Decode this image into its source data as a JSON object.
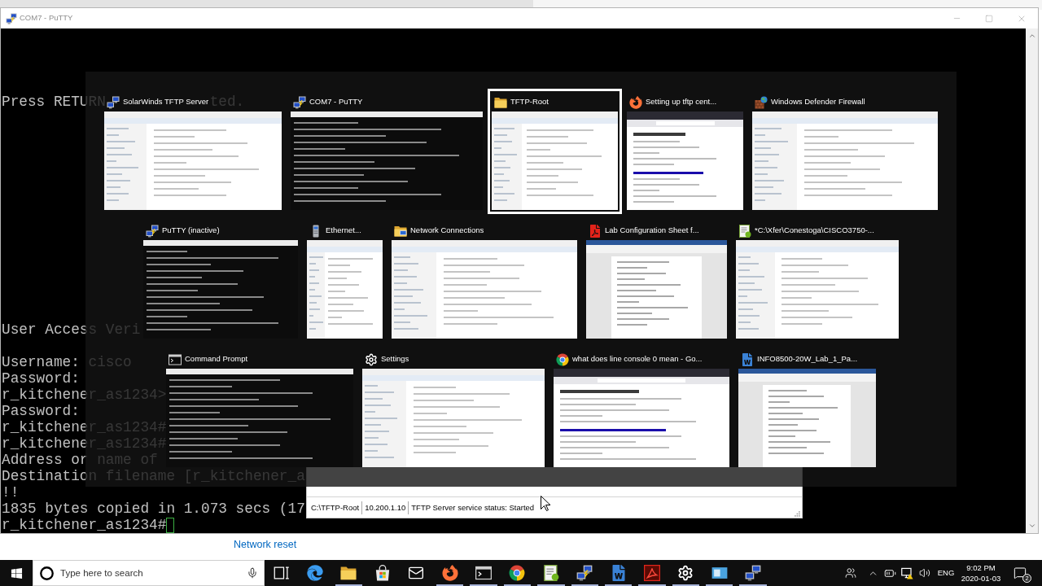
{
  "putty_window": {
    "title": "COM7 - PuTTY",
    "terminal_lines": [
      "Press RETURN            ted.",
      "User Access Veri",
      "Username: cisco",
      "Password:",
      "r_kitchener_as1234>",
      "Password:",
      "r_kitchener_as1234#",
      "r_kitchener_as1234#",
      "Address or name of",
      "Destination filename [r_kitchener_a",
      "!!",
      "1835 bytes copied in 1.073 secs (17",
      "r_kitchener_as1234#"
    ]
  },
  "task_switcher": {
    "rows": [
      {
        "windows": [
          {
            "title": "SolarWinds TFTP Server",
            "kind": "window",
            "selected": false
          },
          {
            "title": "COM7 - PuTTY",
            "kind": "terminal",
            "selected": false
          },
          {
            "title": "TFTP-Root",
            "kind": "window",
            "selected": true
          },
          {
            "title": "Setting up tftp cent...",
            "kind": "browser",
            "selected": false
          },
          {
            "title": "Windows Defender Firewall",
            "kind": "window",
            "selected": false
          }
        ]
      },
      {
        "windows": [
          {
            "title": "PuTTY (inactive)",
            "kind": "terminal",
            "selected": false
          },
          {
            "title": "Ethernet...",
            "kind": "window",
            "selected": false
          },
          {
            "title": "Network Connections",
            "kind": "window",
            "selected": false
          },
          {
            "title": "Lab Configuration Sheet f...",
            "kind": "document",
            "selected": false
          },
          {
            "title": "*C:\\Xfer\\Conestoga\\CISCO3750-...",
            "kind": "window",
            "selected": false
          }
        ]
      },
      {
        "windows": [
          {
            "title": "Command Prompt",
            "kind": "terminal",
            "selected": false
          },
          {
            "title": "Settings",
            "kind": "window",
            "selected": false
          },
          {
            "title": "what does line console 0 mean - Go...",
            "kind": "browser",
            "selected": false
          },
          {
            "title": "INFO8500-20W_Lab_1_Pa...",
            "kind": "document",
            "selected": false
          }
        ]
      }
    ]
  },
  "tftp_server_window": {
    "status_bar": [
      "C:\\TFTP-Root",
      "10.200.1.10",
      "TFTP Server service status: Started"
    ]
  },
  "settings_window": {
    "link": "Network reset"
  },
  "taskbar": {
    "search": {
      "placeholder": "Type here to search"
    },
    "apps": [
      {
        "running": false
      },
      {
        "running": false
      },
      {
        "running": true
      },
      {
        "running": false
      },
      {
        "running": false
      },
      {
        "running": true
      },
      {
        "running": true
      },
      {
        "running": true
      },
      {
        "running": true
      },
      {
        "running": true
      },
      {
        "running": true
      },
      {
        "running": true
      },
      {
        "running": true
      },
      {
        "running": true
      },
      {
        "running": true
      }
    ],
    "tray": {
      "language": "ENG",
      "time": "9:02 PM",
      "date": "2020-01-03",
      "notification_count": "2"
    }
  }
}
